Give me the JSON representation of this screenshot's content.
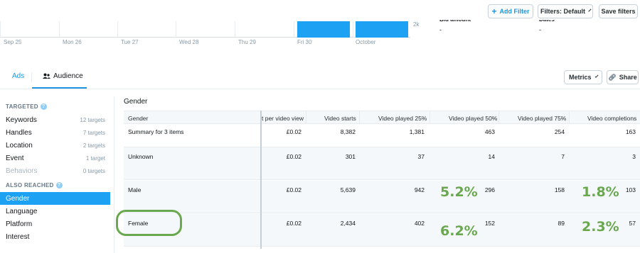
{
  "toolbar": {
    "add_filter": "Add Filter",
    "filters_default": "Filters: Default",
    "save_filters": "Save filters"
  },
  "chart_data": {
    "type": "bar",
    "categories": [
      "Sep 25",
      "Mon 26",
      "Tue 27",
      "Wed 28",
      "Thu 29",
      "Fri 30",
      "October"
    ],
    "y_tick_top": "2k",
    "highlighted_bars": [
      "Fri 30",
      "October"
    ],
    "bar_color": "#1da1f2"
  },
  "stats": [
    {
      "label": "Bid amount",
      "value": "-"
    },
    {
      "label": "Dates",
      "value": "-"
    }
  ],
  "tabs": {
    "ads": "Ads",
    "audience": "Audience",
    "metrics": "Metrics",
    "share": "Share"
  },
  "sidebar": {
    "targeted_heading": "TARGETED",
    "targeted": [
      {
        "label": "Keywords",
        "count": "12 targets"
      },
      {
        "label": "Handles",
        "count": "7 targets"
      },
      {
        "label": "Location",
        "count": "2 targets"
      },
      {
        "label": "Event",
        "count": "1 target"
      },
      {
        "label": "Behaviors",
        "count": "0 targets"
      }
    ],
    "reached_heading": "ALSO REACHED",
    "reached": [
      {
        "label": "Gender"
      },
      {
        "label": "Language"
      },
      {
        "label": "Platform"
      },
      {
        "label": "Interest"
      }
    ]
  },
  "table": {
    "section_title": "Gender",
    "columns": [
      "Gender",
      "t per video view",
      "Video starts",
      "Video played 25%",
      "Video played 50%",
      "Video played 75%",
      "Video completions"
    ],
    "summary": {
      "label": "Summary for 3 items",
      "values": [
        "£0.02",
        "8,382",
        "1,381",
        "463",
        "254",
        "163"
      ]
    },
    "rows": [
      {
        "label": "Unknown",
        "values": [
          "£0.02",
          "301",
          "37",
          "14",
          "7",
          "3"
        ]
      },
      {
        "label": "Male",
        "values": [
          "£0.02",
          "5,639",
          "942",
          "296",
          "158",
          "103"
        ]
      },
      {
        "label": "Female",
        "values": [
          "£0.02",
          "2,434",
          "402",
          "152",
          "89",
          "57"
        ]
      }
    ]
  },
  "annotations": {
    "male_50": "5.2%",
    "male_completion": "1.8%",
    "female_50": "6.2%",
    "female_completion": "2.3%",
    "accent": "#6aa84f"
  }
}
